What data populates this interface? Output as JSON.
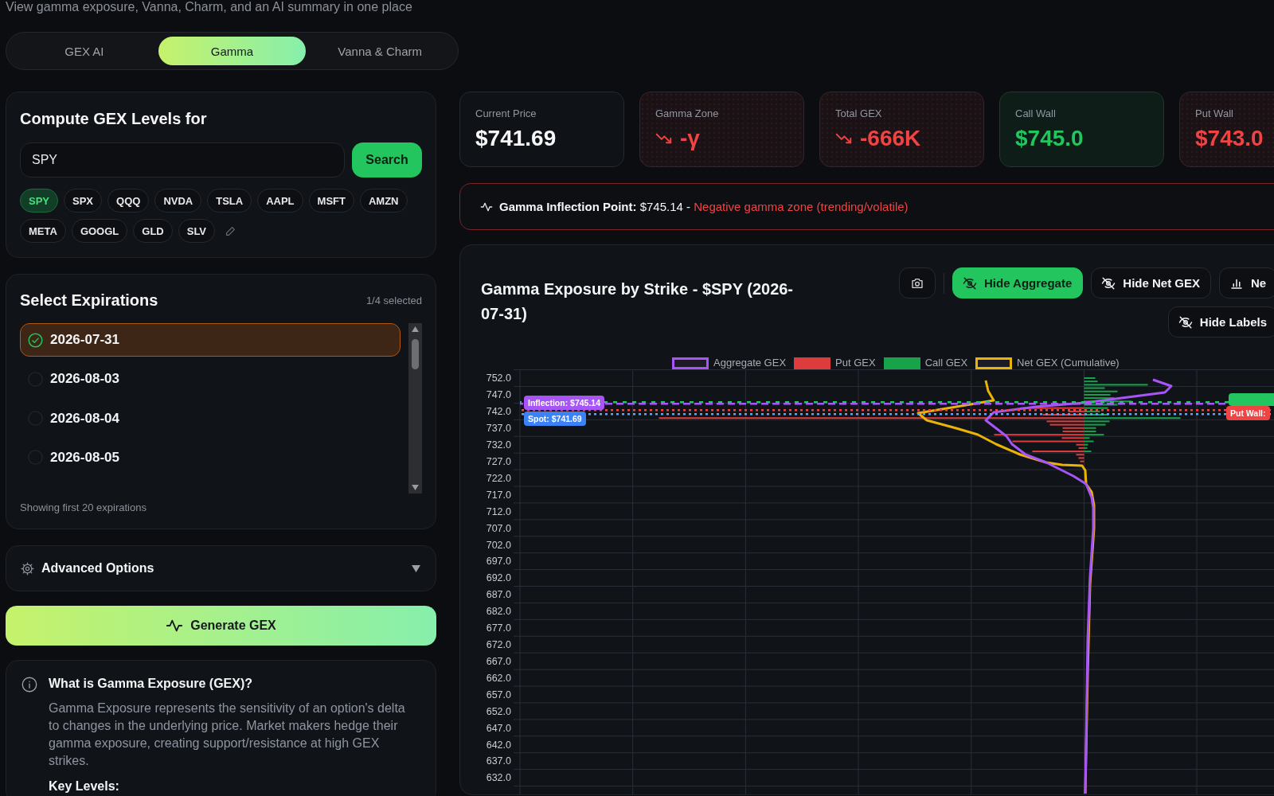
{
  "subtitle": "View gamma exposure, Vanna, Charm, and an AI summary in one place",
  "tabs": [
    {
      "label": "GEX AI",
      "selected": false
    },
    {
      "label": "Gamma",
      "selected": true
    },
    {
      "label": "Vanna & Charm",
      "selected": false
    }
  ],
  "compute_panel": {
    "title": "Compute GEX Levels for",
    "ticker_input": {
      "value": "SPY"
    },
    "search_button": "Search",
    "tickers": [
      {
        "label": "SPY",
        "selected": true
      },
      {
        "label": "SPX",
        "selected": false
      },
      {
        "label": "QQQ",
        "selected": false
      },
      {
        "label": "NVDA",
        "selected": false
      },
      {
        "label": "TSLA",
        "selected": false
      },
      {
        "label": "AAPL",
        "selected": false
      },
      {
        "label": "MSFT",
        "selected": false
      },
      {
        "label": "AMZN",
        "selected": false
      },
      {
        "label": "META",
        "selected": false
      },
      {
        "label": "GOOGL",
        "selected": false
      },
      {
        "label": "GLD",
        "selected": false
      },
      {
        "label": "SLV",
        "selected": false
      }
    ]
  },
  "expirations_panel": {
    "title": "Select Expirations",
    "selection_count": "1/4 selected",
    "items": [
      {
        "date": "2026-07-31",
        "selected": true
      },
      {
        "date": "2026-08-03",
        "selected": false
      },
      {
        "date": "2026-08-04",
        "selected": false
      },
      {
        "date": "2026-08-05",
        "selected": false
      }
    ],
    "footnote": "Showing first 20 expirations"
  },
  "advanced_options": {
    "label": "Advanced Options",
    "expanded": false
  },
  "generate_button": {
    "label": "Generate GEX"
  },
  "info_panel": {
    "title": "What is Gamma Exposure (GEX)?",
    "body": "Gamma Exposure represents the sensitivity of an option's delta to changes in the underlying price. Market makers hedge their gamma exposure, creating support/resistance at high GEX strikes.",
    "subheading": "Key Levels:"
  },
  "stats": [
    {
      "label": "Current Price",
      "value": "$741.69",
      "kind": "neutral",
      "falling": false
    },
    {
      "label": "Gamma Zone",
      "value": "-γ",
      "kind": "negative",
      "falling": true
    },
    {
      "label": "Total GEX",
      "value": "-666K",
      "kind": "negative",
      "falling": true
    },
    {
      "label": "Call Wall",
      "value": "$745.0",
      "kind": "positive",
      "falling": false
    },
    {
      "label": "Put Wall",
      "value": "$743.0",
      "kind": "negative",
      "falling": false
    }
  ],
  "inflection_banner": {
    "text": "**Gamma Inflection Point:** $745.14 -",
    "status": "Negative gamma zone (trending/volatile)",
    "negative": true
  },
  "chart_panel": {
    "title": "Gamma Exposure by Strike - $SPY (2026-07-31)",
    "toolbar_rows": [
      [
        {
          "label": "Hide Aggregate",
          "kind": "visibility",
          "active": true
        },
        {
          "label": "Hide Net GEX",
          "kind": "visibility",
          "active": false
        },
        {
          "label": "Ne",
          "kind": "chart-mode",
          "active": false
        }
      ],
      [
        {
          "label": "Hide Labels",
          "kind": "visibility",
          "active": false
        }
      ]
    ],
    "legend": [
      {
        "label": "Aggregate GEX",
        "color": "#a855f7",
        "kind": "line"
      },
      {
        "label": "Put GEX",
        "color": "#dc3c3c",
        "kind": "bar"
      },
      {
        "label": "Call GEX",
        "color": "#16a34a",
        "kind": "bar"
      },
      {
        "label": "Net GEX (Cumulative)",
        "color": "#eab308",
        "kind": "line"
      }
    ],
    "y_axis_labels": [
      "752.0",
      "747.0",
      "742.0",
      "737.0",
      "732.0",
      "727.0",
      "722.0",
      "717.0",
      "712.0",
      "707.0",
      "702.0",
      "697.0",
      "692.0",
      "687.0",
      "682.0",
      "677.0",
      "672.0",
      "667.0",
      "662.0",
      "657.0",
      "652.0",
      "647.0",
      "642.0",
      "637.0",
      "632.0"
    ],
    "left_tags": [
      {
        "label": "Inflection: $745.14",
        "color": "#a855f7"
      },
      {
        "label": "Spot: $741.69",
        "color": "#3b82f6"
      }
    ],
    "right_tags": [
      {
        "label": "Put Wall:",
        "color": "#ef4444"
      }
    ]
  }
}
